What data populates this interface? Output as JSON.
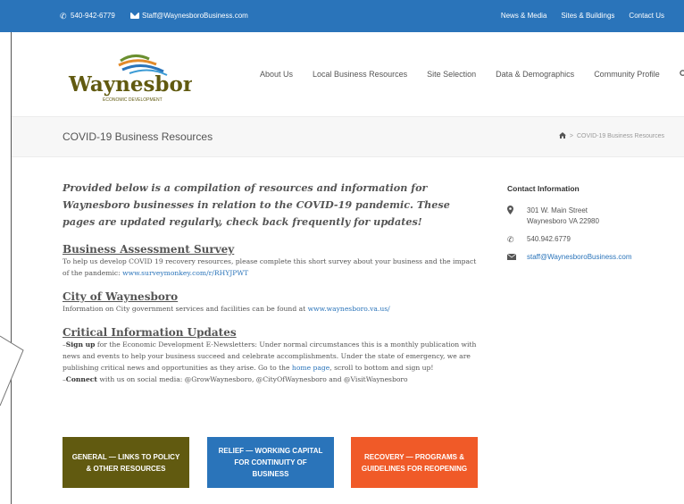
{
  "topbar": {
    "phone": "540-942-6779",
    "email": "Staff@WaynesboroBusiness.com",
    "links": [
      "News & Media",
      "Sites & Buildings",
      "Contact Us"
    ]
  },
  "logo": {
    "name": "Waynesboro",
    "tagline": "ECONOMIC DEVELOPMENT"
  },
  "nav": {
    "items": [
      "About Us",
      "Local Business Resources",
      "Site Selection",
      "Data & Demographics",
      "Community Profile"
    ],
    "search_icon": "search-icon"
  },
  "page": {
    "title": "COVID-19 Business Resources",
    "breadcrumb": "COVID-19 Business Resources"
  },
  "main": {
    "intro": "Provided below is a compilation of resources and information for Waynesboro businesses in relation to the COVID-19 pandemic.  These pages are updated regularly, check back frequently for updates!",
    "survey": {
      "title": "Business Assessment Survey",
      "text": "To help us develop COVID 19 recovery resources, please complete this short survey about your business and the impact of the pandemic: ",
      "link": "www.surveymonkey.com/r/RHYJPWT"
    },
    "city": {
      "title": "City of Waynesboro",
      "text": "Information on City government services and facilities can be found at ",
      "link": "www.waynesboro.va.us/"
    },
    "critical": {
      "title": "Critical Information Updates",
      "line1_prefix": "–",
      "line1_bold": "Sign up",
      "line1_text": " for the Economic Development E-Newsletters: Under normal circumstances this is a monthly publication with news and events to help your business succeed and celebrate accomplishments. Under the state of emergency, we are publishing critical news and opportunities as they arise.  Go to the ",
      "home_link": "home page",
      "line1_end": ", scroll to bottom and sign up!",
      "line2_prefix": "–",
      "line2_bold": "Connect",
      "line2_text": " with us on social media: @GrowWaynesboro, @CityOfWaynesboro and @VisitWaynesboro"
    }
  },
  "buttons": [
    {
      "label": "GENERAL — LINKS TO POLICY & OTHER RESOURCES",
      "color": "#615a10"
    },
    {
      "label": "RELIEF — WORKING CAPITAL FOR CONTINUITY OF BUSINESS",
      "color": "#2a74ba"
    },
    {
      "label": "RECOVERY — PROGRAMS & GUIDELINES FOR REOPENING",
      "color": "#f05a28"
    }
  ],
  "sidebar": {
    "title": "Contact Information",
    "address1": "301 W. Main Street",
    "address2": "Waynesboro VA 22980",
    "phone": "540.942.6779",
    "email": "staff@WaynesboroBusiness.com"
  },
  "colors": {
    "topbar": "#2a74ba",
    "link": "#2a74ba",
    "olive": "#615a10",
    "orange": "#f05a28"
  }
}
